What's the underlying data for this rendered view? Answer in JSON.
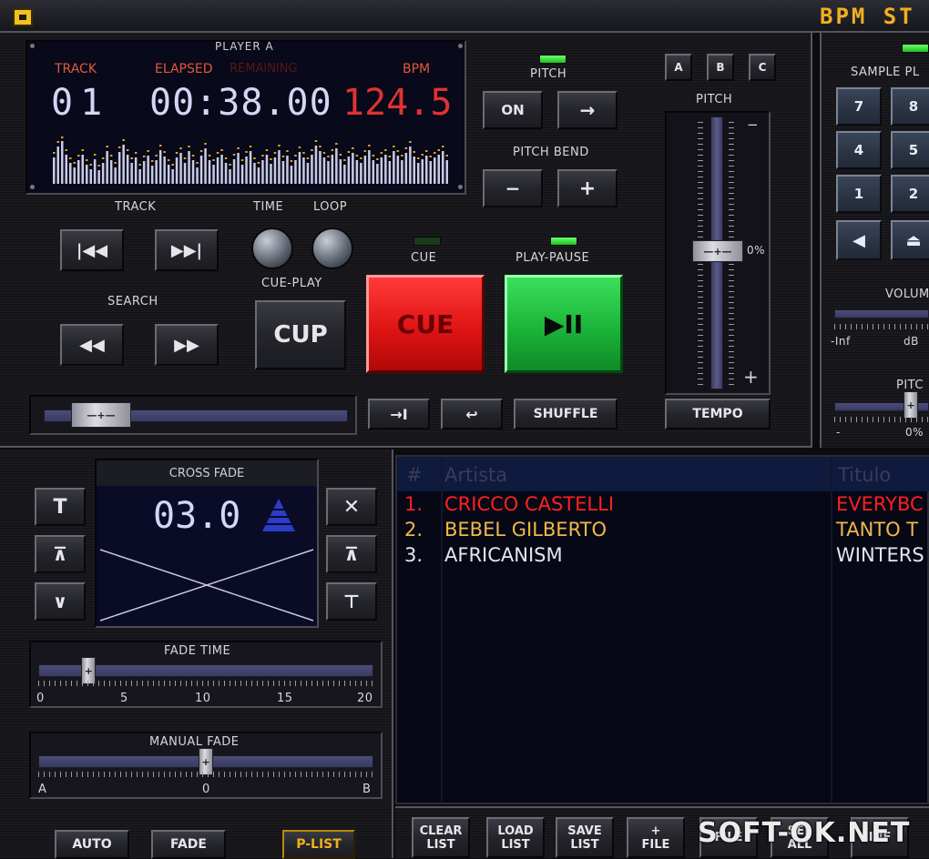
{
  "app": {
    "title": "BPM ST"
  },
  "player": {
    "title": "PLAYER A",
    "labels": {
      "track": "TRACK",
      "elapsed": "ELAPSED",
      "remaining": "REMAINING",
      "bpm": "BPM"
    },
    "track_number": "01",
    "time": "00:38.00",
    "bpm_value": "124.5",
    "spectrum": [
      0.55,
      0.78,
      0.9,
      0.62,
      0.45,
      0.35,
      0.5,
      0.62,
      0.4,
      0.3,
      0.52,
      0.28,
      0.45,
      0.7,
      0.5,
      0.35,
      0.68,
      0.82,
      0.62,
      0.45,
      0.55,
      0.3,
      0.48,
      0.6,
      0.38,
      0.5,
      0.72,
      0.58,
      0.4,
      0.3,
      0.55,
      0.65,
      0.45,
      0.7,
      0.5,
      0.35,
      0.6,
      0.75,
      0.5,
      0.4,
      0.55,
      0.62,
      0.45,
      0.3,
      0.52,
      0.66,
      0.4,
      0.58,
      0.7,
      0.45,
      0.35,
      0.5,
      0.62,
      0.42,
      0.55,
      0.72,
      0.48,
      0.6,
      0.38,
      0.5,
      0.68,
      0.55,
      0.45,
      0.62,
      0.8,
      0.7,
      0.55,
      0.48,
      0.62,
      0.75,
      0.52,
      0.4,
      0.58,
      0.66,
      0.5,
      0.45,
      0.6,
      0.72,
      0.5,
      0.42,
      0.55,
      0.62,
      0.48,
      0.7,
      0.6,
      0.5,
      0.66,
      0.78,
      0.58,
      0.45,
      0.52,
      0.6,
      0.48,
      0.55,
      0.62,
      0.7,
      0.5
    ]
  },
  "pitch": {
    "title": "PITCH",
    "on": "ON",
    "arrow": "→"
  },
  "pitch_bend": {
    "title": "PITCH BEND",
    "minus": "−",
    "plus": "+"
  },
  "abc": [
    "A",
    "B",
    "C"
  ],
  "pitch_fader": {
    "title": "PITCH",
    "zero": "0%",
    "minus": "−",
    "plus": "+",
    "tempo": "TEMPO"
  },
  "transport": {
    "track_label": "TRACK",
    "time_label": "TIME",
    "loop_label": "LOOP",
    "search_label": "SEARCH",
    "cue_play_label": "CUE-PLAY",
    "cup": "CUP",
    "cue_label": "CUE",
    "cue_button": "CUE",
    "play_pause_label": "PLAY-PAUSE",
    "play_pause_glyph": "▶II"
  },
  "bottom_row": {
    "shuffle": "SHUFFLE"
  },
  "sampler": {
    "title": "SAMPLE PL",
    "keys": [
      "7",
      "8",
      "4",
      "5",
      "1",
      "2"
    ],
    "volume": "VOLUM",
    "inf": "-Inf",
    "db": "dB",
    "pitch": "PITC",
    "pitch_minus": "-",
    "pitch_zero": "0%"
  },
  "crossfade": {
    "title": "CROSS FADE",
    "value": "03.0",
    "fade_time_title": "FADE TIME",
    "fade_time_scale": [
      "0",
      "5",
      "10",
      "15",
      "20"
    ],
    "fade_time_value": 3,
    "manual_title": "MANUAL FADE",
    "manual_scale": [
      "A",
      "0",
      "B"
    ],
    "manual_value": 0
  },
  "bottom_buttons": {
    "auto": "AUTO",
    "fade": "FADE",
    "plist": "P-LIST"
  },
  "playlist": {
    "headers": {
      "num": "#",
      "artist": "Artista",
      "title": "Titulo"
    },
    "rows": [
      {
        "num": "1.",
        "artist": "CRICCO CASTELLI",
        "title": "EVERYBC",
        "color": "#ff2020"
      },
      {
        "num": "2.",
        "artist": "BEBEL GILBERTO",
        "title": "TANTO T",
        "color": "#f0b84a"
      },
      {
        "num": "3.",
        "artist": "AFRICANISM",
        "title": "WINTERS",
        "color": "#e6e6ee"
      }
    ]
  },
  "list_buttons": {
    "clear": [
      "CLEAR",
      "LIST"
    ],
    "load": [
      "LOAD",
      "LIST"
    ],
    "save": [
      "SAVE",
      "LIST"
    ],
    "add": [
      "+",
      "FILE"
    ],
    "file2": [
      "",
      "FILE"
    ],
    "sel": [
      "SEL",
      "ALL"
    ],
    "inf": [
      "",
      "INF"
    ]
  },
  "watermark": "SOFT-OK.NET",
  "colors": {
    "red": "#ff2020",
    "green": "#22c23a",
    "lcd_blue": "#0a0e3a",
    "accent": "#f2b01e"
  }
}
